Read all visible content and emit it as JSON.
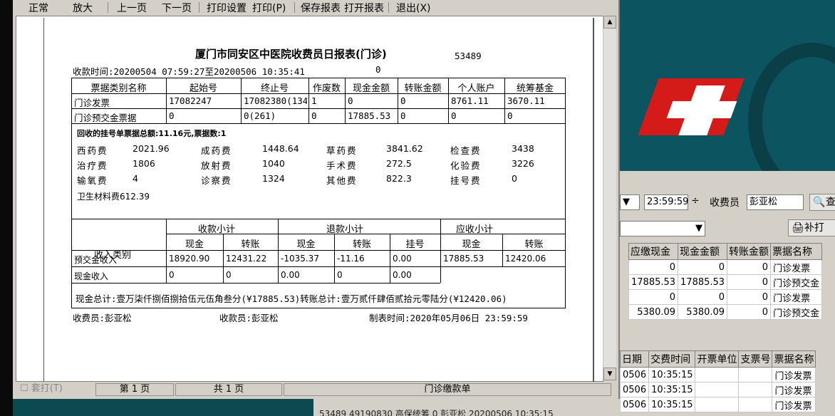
{
  "toolbar": {
    "normal": "正常",
    "zoom": "放大",
    "prev": "上一页",
    "next": "下一页",
    "print_setup": "打印设置",
    "print": "打印(P)",
    "save": "保存报表",
    "open": "打开报表",
    "exit": "退出(X)"
  },
  "report": {
    "title": "厦门市同安区中医院收费员日报表(门诊)",
    "code": "53489",
    "time_label": "收款时间:20200504 07:59:27至20200506 10:35:41",
    "time_zero": "0",
    "bill_headers": [
      "票据类别名称",
      "起始号",
      "终止号",
      "作废数",
      "现金金额",
      "转账金额",
      "个人账户",
      "统筹基金"
    ],
    "bill_rows": [
      [
        "门诊发票",
        "17082247",
        "17082380(134",
        "1",
        "0",
        "0",
        "8761.11",
        "3670.11"
      ],
      [
        "门诊预交金票据",
        "0",
        "0(261)",
        "0",
        "17885.53",
        "0",
        "0",
        "0"
      ]
    ],
    "recycle_note": "回收的挂号单票据总额:11.16元,票据数:1",
    "fees": [
      [
        "西药费",
        "2021.96"
      ],
      [
        "成药费",
        "1448.64"
      ],
      [
        "草药费",
        "3841.62"
      ],
      [
        "检查费",
        "3438"
      ],
      [
        "治疗费",
        "1806"
      ],
      [
        "放射费",
        "1040"
      ],
      [
        "手术费",
        "272.5"
      ],
      [
        "化验费",
        "3226"
      ],
      [
        "输氧费",
        "4"
      ],
      [
        "诊察费",
        "1324"
      ],
      [
        "其他费",
        "822.3"
      ],
      [
        "挂号费",
        "0"
      ]
    ],
    "material_fee": "卫生材料费612.39",
    "income": {
      "category_header": "收入类别",
      "groups": [
        "收款小计",
        "退款小计",
        "应收小计"
      ],
      "sub": [
        "现金",
        "转账",
        "现金",
        "转账",
        "挂号",
        "现金",
        "转账"
      ],
      "rows": [
        [
          "预交金收入",
          "18920.90",
          "12431.22",
          "-1035.37",
          "-11.16",
          "0.00",
          "17885.53",
          "12420.06"
        ],
        [
          "现金收入",
          "0",
          "0",
          "0.00",
          "0",
          "0.00",
          "",
          ""
        ]
      ]
    },
    "total_line": "现金总计:壹万柒仟捌佰捌拾伍元伍角叁分(¥17885.53)转账总计:壹万贰仟肆佰贰拾元零陆分(¥12420.06)",
    "cashier": "收费员:彭亚松",
    "receiver": "收款员:彭亚松",
    "made_time": "制表时间:2020年05月06日 23:59:59"
  },
  "statusbar": {
    "reprint": "套打(T)",
    "page": "第 1 页",
    "total": "共 1 页",
    "doc": "门诊缴款单"
  },
  "background": {
    "time_value": "23:59:59",
    "cashier_label": "收费员",
    "cashier_value": "彭亚松",
    "search_label": "查",
    "reprint_label": "补打",
    "grid1_headers": [
      "应缴现金",
      "现金金额",
      "转账金额",
      "票据名称"
    ],
    "grid1_rows": [
      [
        "0",
        "0",
        "0",
        "门诊发票"
      ],
      [
        "17885.53",
        "17885.53",
        "0",
        "门诊预交金"
      ],
      [
        "0",
        "0",
        "0",
        "门诊发票"
      ],
      [
        "5380.09",
        "5380.09",
        "0",
        "门诊预交金"
      ]
    ],
    "grid2_headers": [
      "日期",
      "交费时间",
      "开票单位",
      "支票号",
      "票据名称"
    ],
    "grid2_rows": [
      [
        "0506",
        "10:35:15",
        "",
        "",
        "门诊发票"
      ],
      [
        "0506",
        "10:35:15",
        "",
        "",
        "门诊发票"
      ],
      [
        "0506",
        "10:35:15",
        "",
        "",
        "门诊发票"
      ]
    ],
    "bottom_row": "53489  49190830 高保统筹  0 彭亚松  20200506 10:35:15"
  },
  "colors": {
    "window_bg": "#d4d0c8",
    "desktop": "#0b4a4f",
    "logo_red": "#d51a1a"
  }
}
